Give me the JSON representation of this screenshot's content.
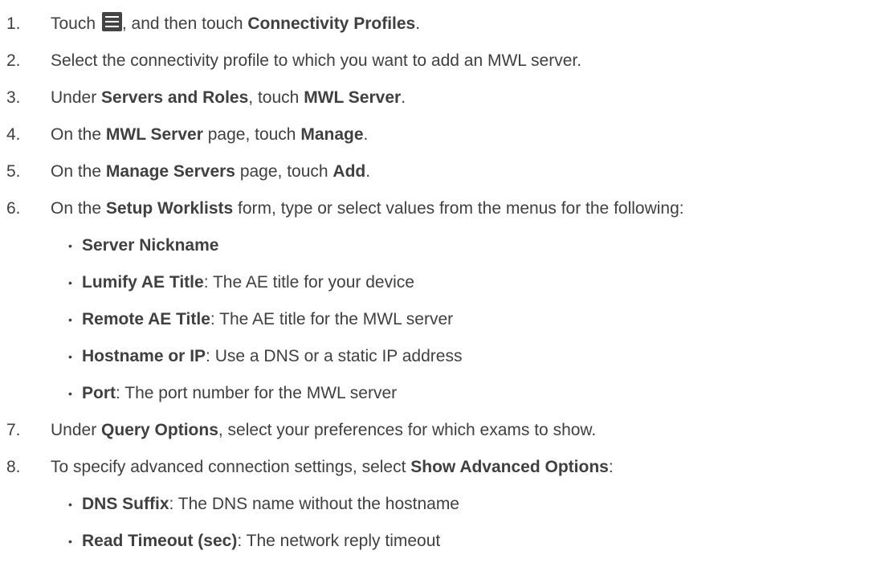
{
  "steps": [
    {
      "num": "1.",
      "p1": "Touch ",
      "icon": "menu-icon",
      "p2": ", and then touch ",
      "b1": "Connectivity Profiles",
      "p3": "."
    },
    {
      "num": "2.",
      "p1": "Select the connectivity profile to which you want to add an MWL server."
    },
    {
      "num": "3.",
      "p1": "Under ",
      "b1": "Servers and Roles",
      "p2": ", touch ",
      "b2": "MWL Server",
      "p3": "."
    },
    {
      "num": "4.",
      "p1": "On the ",
      "b1": "MWL Server",
      "p2": " page, touch ",
      "b2": "Manage",
      "p3": "."
    },
    {
      "num": "5.",
      "p1": "On the ",
      "b1": "Manage Servers",
      "p2": " page, touch ",
      "b2": "Add",
      "p3": "."
    },
    {
      "num": "6.",
      "p1": "On the ",
      "b1": "Setup Worklists",
      "p2": " form, type or select values from the menus for the following:",
      "bullets": [
        {
          "b": "Server Nickname",
          "t": ""
        },
        {
          "b": "Lumify AE Title",
          "t": ": The AE title for your device"
        },
        {
          "b": "Remote AE Title",
          "t": ": The AE title for the MWL server"
        },
        {
          "b": "Hostname or IP",
          "t": ": Use a DNS or a static IP address"
        },
        {
          "b": "Port",
          "t": ": The port number for the MWL server"
        }
      ]
    },
    {
      "num": "7.",
      "p1": "Under ",
      "b1": "Query Options",
      "p2": ", select your preferences for which exams to show."
    },
    {
      "num": "8.",
      "p1": "To specify advanced connection settings, select ",
      "b1": "Show Advanced Options",
      "p2": ":",
      "bullets": [
        {
          "b": "DNS Suffix",
          "t": ": The DNS name without the hostname"
        },
        {
          "b": "Read Timeout (sec)",
          "t": ": The network reply timeout"
        }
      ]
    }
  ],
  "bullet_char": "•"
}
